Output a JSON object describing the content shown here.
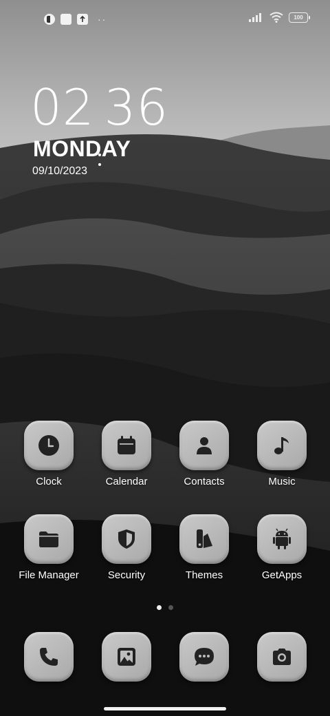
{
  "status_bar": {
    "battery": "100",
    "left_icons": [
      "notification-app-icon",
      "notification-square-icon",
      "upload-icon"
    ],
    "more_indicator": "··",
    "right_icons": [
      "signal-icon",
      "wifi-icon",
      "battery-icon"
    ]
  },
  "clock_widget": {
    "hours": "02",
    "minutes": "36",
    "day": "MONDAY",
    "date": "09/10/2023"
  },
  "apps": [
    {
      "label": "Clock",
      "icon": "clock-icon"
    },
    {
      "label": "Calendar",
      "icon": "calendar-icon"
    },
    {
      "label": "Contacts",
      "icon": "contacts-icon"
    },
    {
      "label": "Music",
      "icon": "music-note-icon"
    },
    {
      "label": "File Manager",
      "icon": "folder-icon"
    },
    {
      "label": "Security",
      "icon": "shield-icon"
    },
    {
      "label": "Themes",
      "icon": "themes-icon"
    },
    {
      "label": "GetApps",
      "icon": "android-icon"
    }
  ],
  "dock": [
    {
      "icon": "phone-icon"
    },
    {
      "icon": "gallery-icon"
    },
    {
      "icon": "messages-icon"
    },
    {
      "icon": "camera-icon"
    }
  ],
  "pages": {
    "total": 2,
    "current": 1
  },
  "colors": {
    "tile_light": "#c9c9c9",
    "tile_dark": "#a9a9a9",
    "glyph": "#222222"
  }
}
